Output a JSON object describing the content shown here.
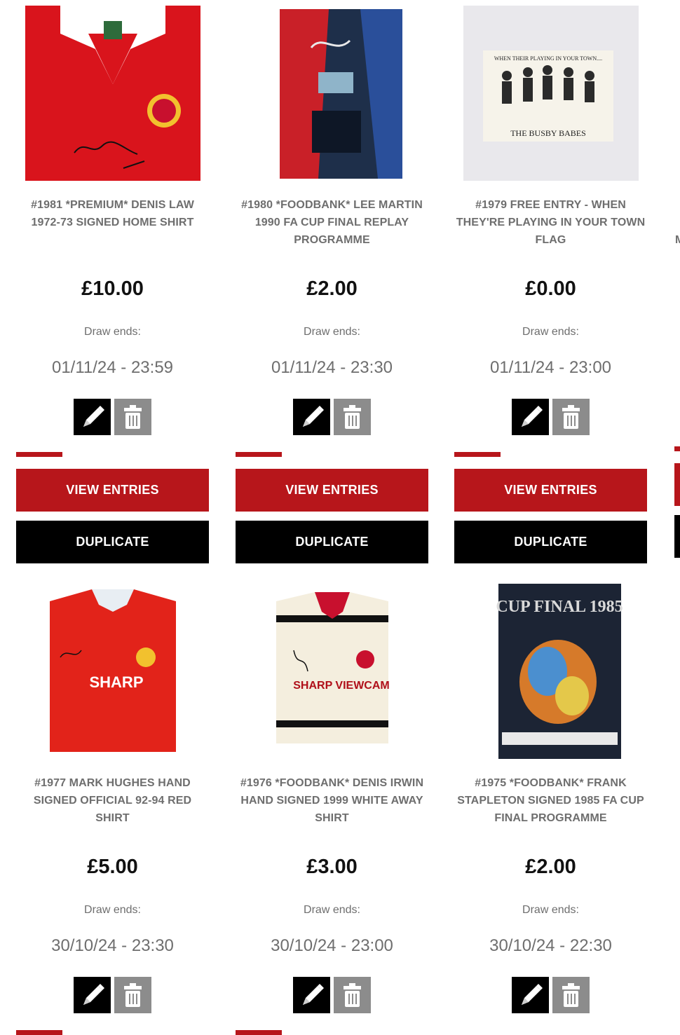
{
  "labels": {
    "draw_ends": "Draw ends:",
    "view_entries": "VIEW ENTRIES",
    "duplicate": "DUPLICATE",
    "edge_letter": "M"
  },
  "colors": {
    "accent": "#b7161b",
    "dark": "#000000",
    "muted": "#6e6e6e",
    "delete_bg": "#8c8c8c"
  },
  "icons": {
    "edit": "pencil-icon",
    "delete": "trash-icon"
  },
  "competitions": [
    {
      "title": "#1981 *PREMIUM* DENIS LAW 1972-73 SIGNED HOME SHIRT",
      "price": "£10.00",
      "draw_ends": "01/11/24 - 23:59",
      "image": "signed-red-retro-shirt"
    },
    {
      "title": "#1980 *FOODBANK* LEE MARTIN 1990 FA CUP FINAL REPLAY PROGRAMME",
      "price": "£2.00",
      "draw_ends": "01/11/24 - 23:30",
      "image": "fa-cup-final-replay-programme"
    },
    {
      "title": "#1979 FREE ENTRY - WHEN THEY'RE PLAYING IN YOUR TOWN FLAG",
      "price": "£0.00",
      "draw_ends": "01/11/24 - 23:00",
      "image": "busby-babes-flag",
      "image_text_top": "WHEN THEIR PLAYING IN YOUR TOWN....",
      "image_text_bottom": "THE BUSBY BABES"
    },
    {
      "title": "#1977 MARK HUGHES HAND SIGNED OFFICIAL 92-94 RED SHIRT",
      "price": "£5.00",
      "draw_ends": "30/10/24 - 23:30",
      "image": "signed-sharp-red-shirt",
      "image_text": "SHARP"
    },
    {
      "title": "#1976 *FOODBANK* DENIS IRWIN HAND SIGNED 1999 WHITE AWAY SHIRT",
      "price": "£3.00",
      "draw_ends": "30/10/24 - 23:00",
      "image": "signed-white-away-shirt",
      "image_text": "SHARP VIEWCAM"
    },
    {
      "title": "#1975 *FOODBANK* FRANK STAPLETON SIGNED 1985 FA CUP FINAL PROGRAMME",
      "price": "£2.00",
      "draw_ends": "30/10/24 - 22:30",
      "image": "cup-final-1985-programme",
      "image_text": "CUP FINAL 1985"
    }
  ]
}
